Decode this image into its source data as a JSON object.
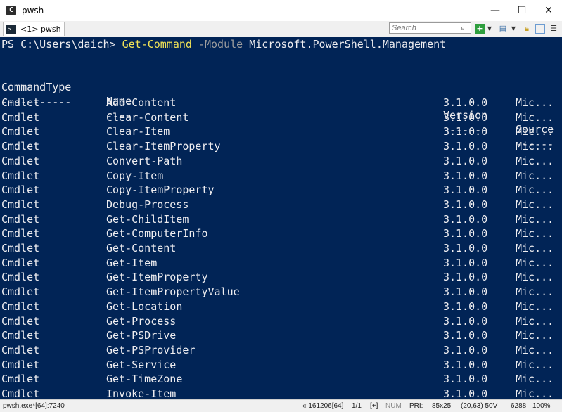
{
  "window": {
    "title": "pwsh",
    "app_icon": "conemu-icon",
    "minimize_glyph": "—",
    "maximize_glyph": "☐",
    "close_glyph": "✕"
  },
  "toolbar": {
    "tab_label": "<1> pwsh",
    "search_placeholder": "Search"
  },
  "console": {
    "prompt": "PS C:\\Users\\daich> ",
    "command": "Get-Command",
    "param_name": " -Module ",
    "param_value": "Microsoft.PowerShell.Management",
    "headers": [
      "CommandType",
      "Name",
      "Version",
      "Source"
    ],
    "separators": [
      "-----------",
      "----",
      "-------",
      "------"
    ],
    "rows": [
      [
        "Cmdlet",
        "Add-Content",
        "3.1.0.0",
        "Mic..."
      ],
      [
        "Cmdlet",
        "Clear-Content",
        "3.1.0.0",
        "Mic..."
      ],
      [
        "Cmdlet",
        "Clear-Item",
        "3.1.0.0",
        "Mic..."
      ],
      [
        "Cmdlet",
        "Clear-ItemProperty",
        "3.1.0.0",
        "Mic..."
      ],
      [
        "Cmdlet",
        "Convert-Path",
        "3.1.0.0",
        "Mic..."
      ],
      [
        "Cmdlet",
        "Copy-Item",
        "3.1.0.0",
        "Mic..."
      ],
      [
        "Cmdlet",
        "Copy-ItemProperty",
        "3.1.0.0",
        "Mic..."
      ],
      [
        "Cmdlet",
        "Debug-Process",
        "3.1.0.0",
        "Mic..."
      ],
      [
        "Cmdlet",
        "Get-ChildItem",
        "3.1.0.0",
        "Mic..."
      ],
      [
        "Cmdlet",
        "Get-ComputerInfo",
        "3.1.0.0",
        "Mic..."
      ],
      [
        "Cmdlet",
        "Get-Content",
        "3.1.0.0",
        "Mic..."
      ],
      [
        "Cmdlet",
        "Get-Item",
        "3.1.0.0",
        "Mic..."
      ],
      [
        "Cmdlet",
        "Get-ItemProperty",
        "3.1.0.0",
        "Mic..."
      ],
      [
        "Cmdlet",
        "Get-ItemPropertyValue",
        "3.1.0.0",
        "Mic..."
      ],
      [
        "Cmdlet",
        "Get-Location",
        "3.1.0.0",
        "Mic..."
      ],
      [
        "Cmdlet",
        "Get-Process",
        "3.1.0.0",
        "Mic..."
      ],
      [
        "Cmdlet",
        "Get-PSDrive",
        "3.1.0.0",
        "Mic..."
      ],
      [
        "Cmdlet",
        "Get-PSProvider",
        "3.1.0.0",
        "Mic..."
      ],
      [
        "Cmdlet",
        "Get-Service",
        "3.1.0.0",
        "Mic..."
      ],
      [
        "Cmdlet",
        "Get-TimeZone",
        "3.1.0.0",
        "Mic..."
      ],
      [
        "Cmdlet",
        "Invoke-Item",
        "3.1.0.0",
        "Mic..."
      ]
    ]
  },
  "statusbar": {
    "process": "pwsh.exe*[64]:7240",
    "pid_info": "« 161206[64]",
    "console_index": "1/1",
    "insert_mode": "[+]",
    "num_lock": "NUM",
    "priority": "PRI:",
    "buffer_size": "85x25",
    "cursor": "(20,63) 50V",
    "pid": "6288",
    "zoom": "100%"
  },
  "colors": {
    "console_bg": "#012456",
    "console_fg": "#eeedf0",
    "command": "#f2e356",
    "parameter": "#9e9e9e"
  }
}
